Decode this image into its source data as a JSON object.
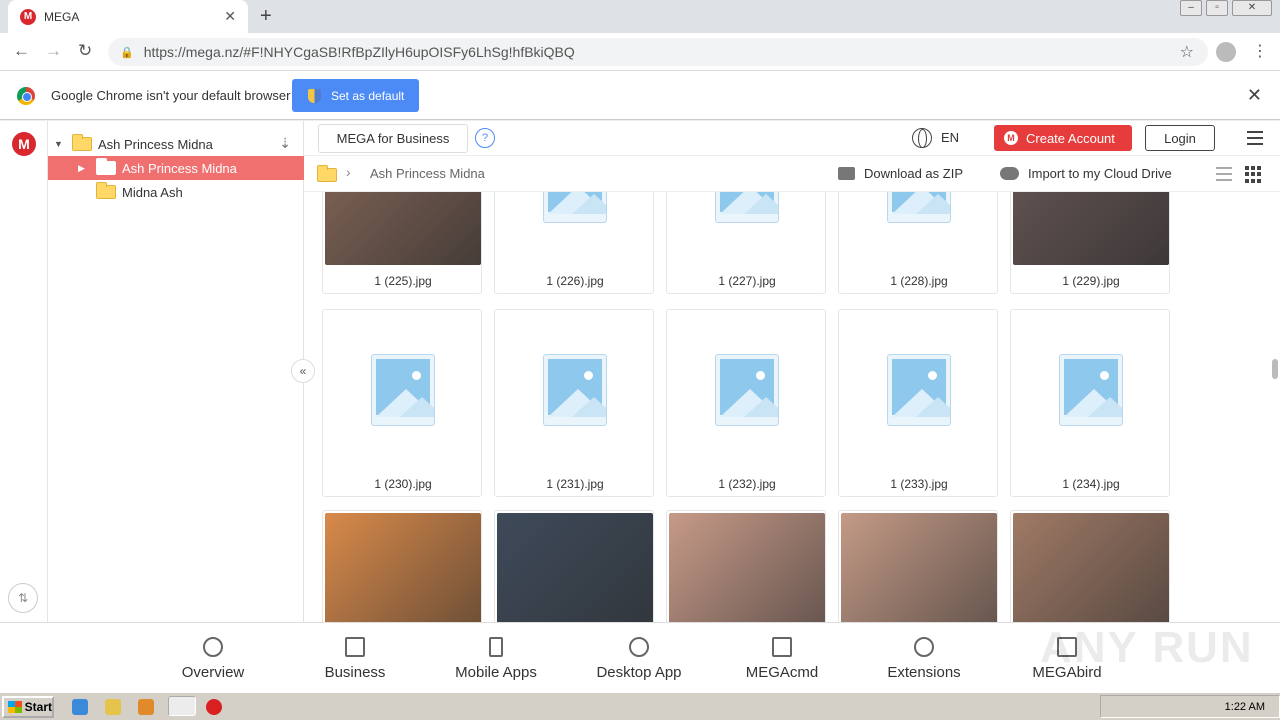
{
  "browser": {
    "tab_title": "MEGA",
    "tab_close": "✕",
    "new_tab": "+",
    "url": "https://mega.nz/#F!NHYCgaSB!RfBpZIlyH6upOISFy6LhSg!hfBkiQBQ",
    "infobar_text": "Google Chrome isn't your default browser",
    "set_default_label": "Set as default",
    "infobar_close": "✕"
  },
  "sidebar": {
    "root_label": "Ash Princess Midna",
    "items": [
      {
        "label": "Ash Princess Midna",
        "selected": true
      },
      {
        "label": "Midna Ash",
        "selected": false
      }
    ]
  },
  "topbar": {
    "business_label": "MEGA for Business",
    "help_label": "?",
    "language": "EN",
    "create_account_label": "Create Account",
    "login_label": "Login"
  },
  "breadcrumb": {
    "current": "Ash Princess Midna",
    "download_zip_label": "Download as ZIP",
    "import_label": "Import to my Cloud Drive"
  },
  "files": [
    {
      "name": "1 (225).jpg",
      "kind": "photo",
      "color": "#8a6a5a"
    },
    {
      "name": "1 (226).jpg",
      "kind": "placeholder"
    },
    {
      "name": "1 (227).jpg",
      "kind": "placeholder"
    },
    {
      "name": "1 (228).jpg",
      "kind": "placeholder"
    },
    {
      "name": "1 (229).jpg",
      "kind": "photo",
      "color": "#6b5a58"
    },
    {
      "name": "1 (230).jpg",
      "kind": "placeholder"
    },
    {
      "name": "1 (231).jpg",
      "kind": "placeholder"
    },
    {
      "name": "1 (232).jpg",
      "kind": "placeholder"
    },
    {
      "name": "1 (233).jpg",
      "kind": "placeholder"
    },
    {
      "name": "1 (234).jpg",
      "kind": "placeholder"
    },
    {
      "name": "",
      "kind": "photo",
      "color": "#d98a4a"
    },
    {
      "name": "",
      "kind": "photo",
      "color": "#3e4a5a"
    },
    {
      "name": "",
      "kind": "photo",
      "color": "#c79a88"
    },
    {
      "name": "",
      "kind": "photo",
      "color": "#c49a86"
    },
    {
      "name": "",
      "kind": "photo",
      "color": "#a07a66"
    }
  ],
  "footer": {
    "items": [
      {
        "label": "Overview"
      },
      {
        "label": "Business"
      },
      {
        "label": "Mobile Apps"
      },
      {
        "label": "Desktop App"
      },
      {
        "label": "MEGAcmd"
      },
      {
        "label": "Extensions"
      },
      {
        "label": "MEGAbird"
      }
    ],
    "watermark": "ANY RUN"
  },
  "taskbar": {
    "start_label": "Start",
    "clock": "1:22 AM"
  },
  "colors": {
    "mega_red": "#d9272e",
    "selection": "#f07070",
    "button_blue": "#4c8bf5"
  }
}
